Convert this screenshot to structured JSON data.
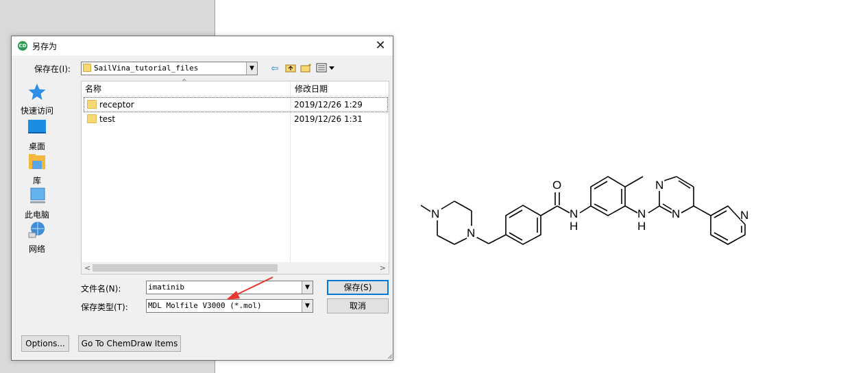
{
  "dialog": {
    "title": "另存为",
    "app_icon_text": "CD",
    "close_symbol": "✕",
    "save_in_label": "保存在(I):",
    "save_in_value": "SailVina_tutorial_files",
    "places": [
      {
        "label": "快速访问",
        "icon": "star-icon"
      },
      {
        "label": "桌面",
        "icon": "desktop-icon"
      },
      {
        "label": "库",
        "icon": "library-icon"
      },
      {
        "label": "此电脑",
        "icon": "computer-icon"
      },
      {
        "label": "网络",
        "icon": "network-icon"
      }
    ],
    "columns": {
      "name": "名称",
      "date": "修改日期"
    },
    "files": [
      {
        "name": "receptor",
        "date": "2019/12/26 1:29"
      },
      {
        "name": "test",
        "date": "2019/12/26 1:31"
      }
    ],
    "filename_label": "文件名(N):",
    "filename_value": "imatinib",
    "filetype_label": "保存类型(T):",
    "filetype_value": "MDL Molfile V3000 (*.mol)",
    "save_button": "保存(S)",
    "cancel_button": "取消",
    "options_button": "Options...",
    "chemdraw_button": "Go To ChemDraw Items"
  },
  "molecule": {
    "atoms": {
      "o": "O",
      "n": "N",
      "h": "H"
    },
    "accent": "#e8352f"
  }
}
